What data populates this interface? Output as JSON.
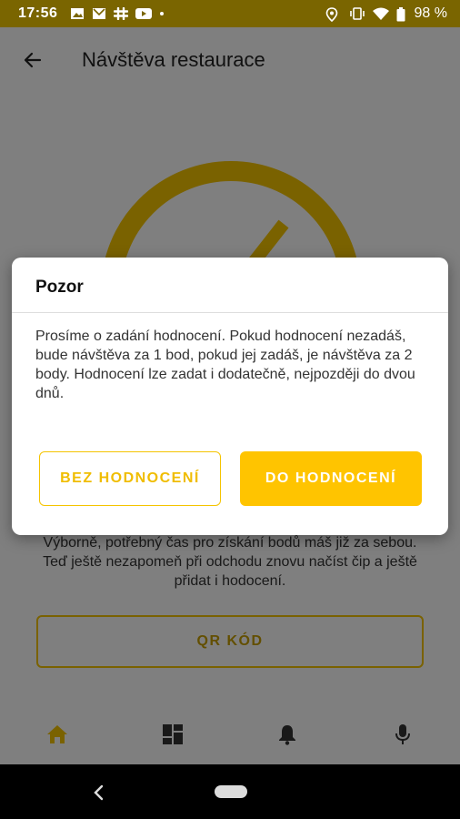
{
  "status_bar": {
    "time": "17:56",
    "battery": "98 %",
    "icons_left": [
      "image-icon",
      "mail-icon",
      "slack-icon",
      "youtube-icon",
      "dot-icon"
    ],
    "icons_right": [
      "location-icon",
      "vibrate-icon",
      "wifi-icon",
      "battery-icon"
    ]
  },
  "app_bar": {
    "title": "Návštěva restaurace"
  },
  "main": {
    "info_text": "Výborně, potřebný čas pro získání bodů máš již za sebou. Teď ještě nezapomeň při odchodu znovu načíst čip a ještě přidat i hodocení.",
    "qr_button_label": "QR KÓD"
  },
  "bottom_nav": {
    "items": [
      "home-icon",
      "dashboard-icon",
      "bell-icon",
      "mic-icon"
    ]
  },
  "dialog": {
    "title": "Pozor",
    "body": "Prosíme o zadání hodnocení. Pokud hodnocení nezadáš, bude návštěva za 1 bod, pokud jej zadáš, je návštěva za 2 body. Hodnocení lze zadat i dodatečně, nejpozději do dvou dnů.",
    "secondary_button": "BEZ HODNOCENÍ",
    "primary_button": "DO HODNOCENÍ"
  },
  "colors": {
    "accent": "#ffc400",
    "status_bar": "#7a6500",
    "active_nav": "#f5c400",
    "inactive_nav": "#333333"
  }
}
